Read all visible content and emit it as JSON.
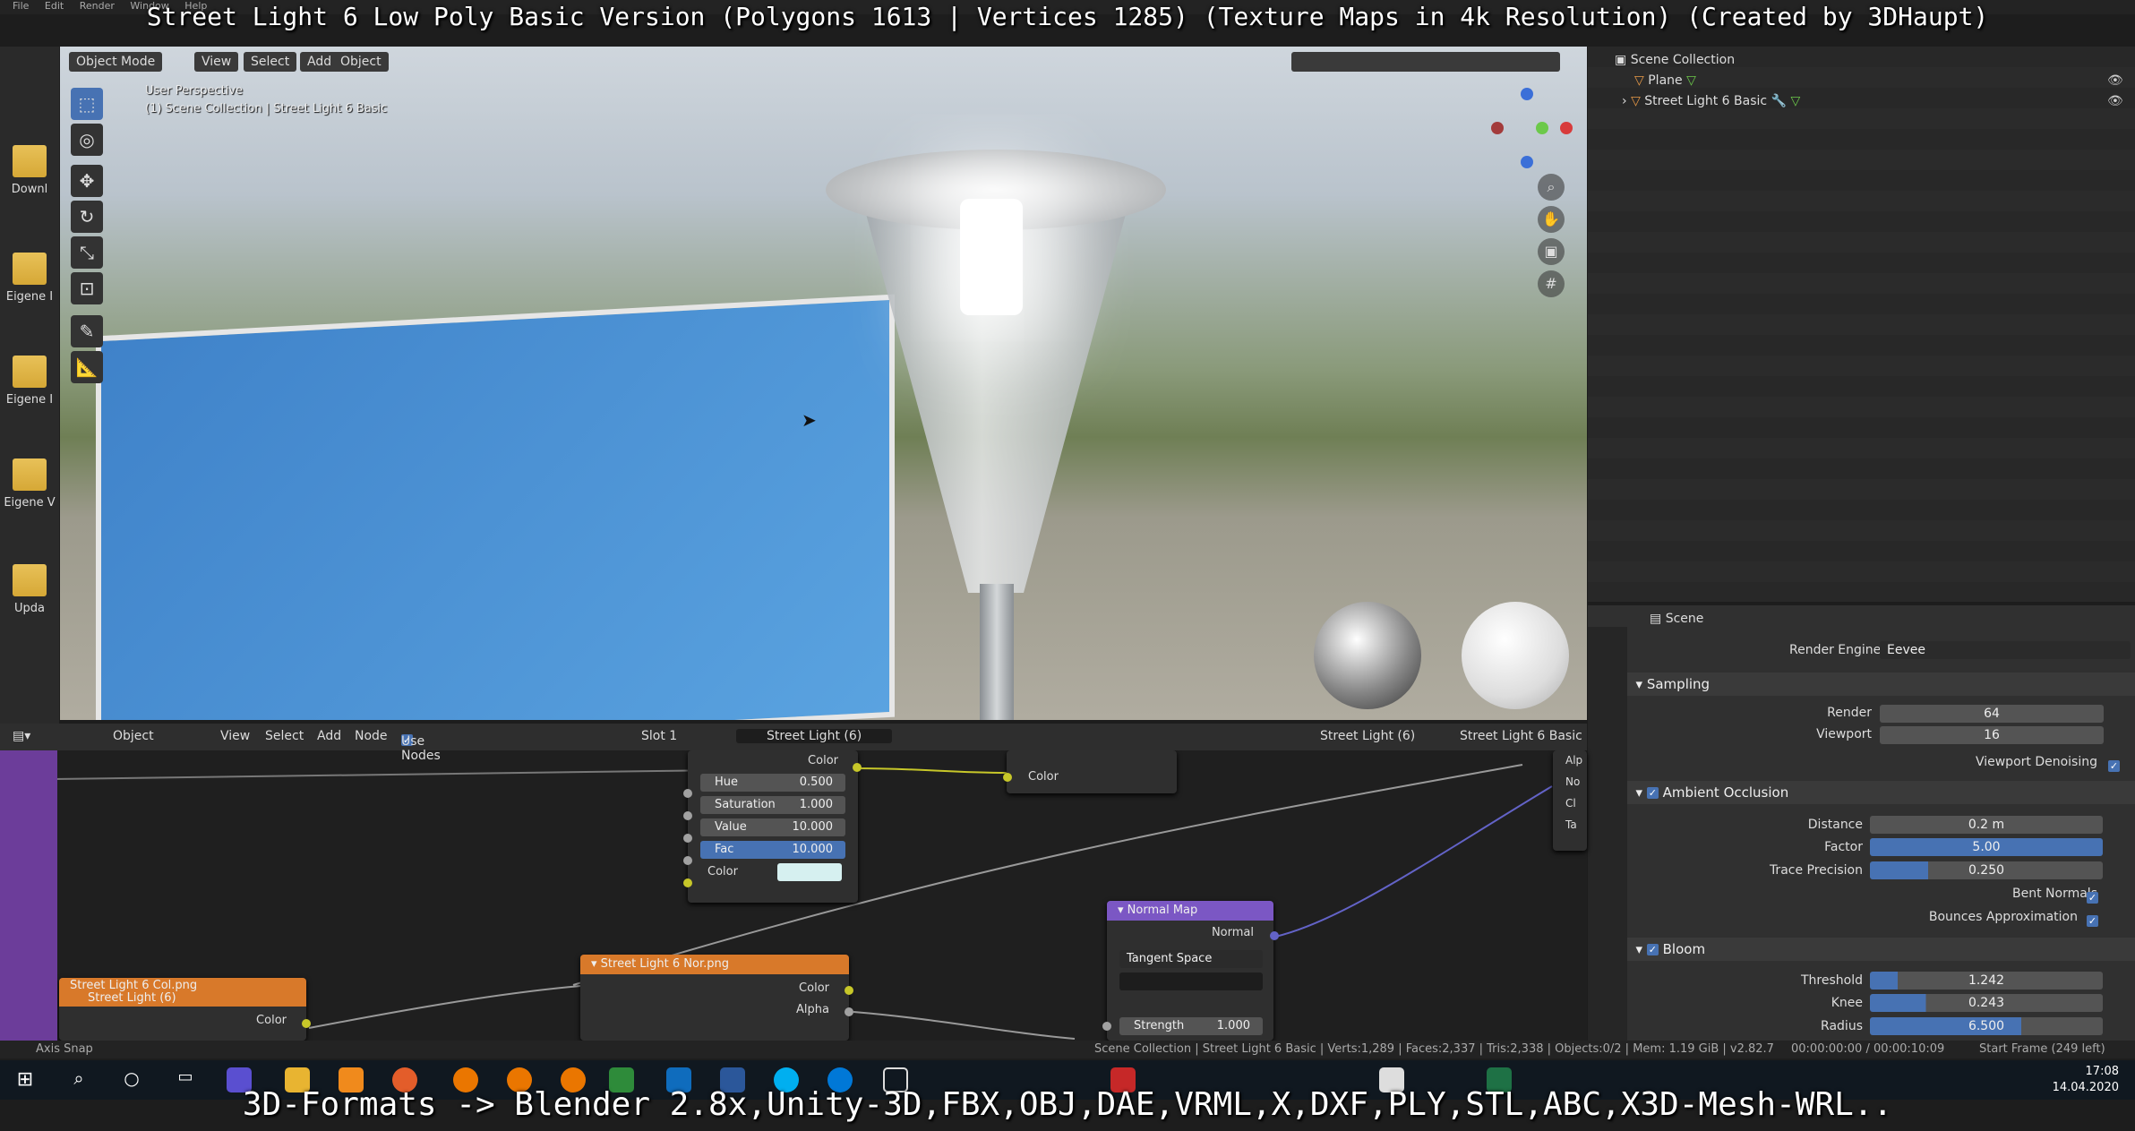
{
  "caption_top": "Street Light 6 Low Poly Basic Version (Polygons 1613 | Vertices 1285) (Texture Maps in 4k Resolution) (Created by 3DHaupt)",
  "caption_bottom": "3D-Formats -> Blender 2.8x,Unity-3D,FBX,OBJ,DAE,VRML,X,DXF,PLY,STL,ABC,X3D-Mesh-WRL..",
  "top_menu": [
    "File",
    "Edit",
    "Render",
    "Window",
    "Help"
  ],
  "desktop_icons": [
    "Downl",
    "Eigene I",
    "Eigene I",
    "Eigene V",
    "Upda"
  ],
  "viewport": {
    "mode": "Object Mode",
    "menus": [
      "View",
      "Select",
      "Add",
      "Object"
    ],
    "perspective": "User Perspective",
    "collection_info": "(1) Scene Collection | Street Light 6 Basic"
  },
  "outliner": {
    "root": "Scene Collection",
    "items": [
      "Plane",
      "Street Light 6 Basic"
    ]
  },
  "properties": {
    "context": "Scene",
    "render_engine_label": "Render Engine",
    "render_engine": "Eevee",
    "sampling": {
      "title": "Sampling",
      "render_label": "Render",
      "render": "64",
      "viewport_label": "Viewport",
      "viewport": "16",
      "denoise_label": "Viewport Denoising"
    },
    "ao": {
      "title": "Ambient Occlusion",
      "distance_label": "Distance",
      "distance": "0.2 m",
      "factor_label": "Factor",
      "factor": "5.00",
      "trace_label": "Trace Precision",
      "trace": "0.250",
      "bent_label": "Bent Normals",
      "bounces_label": "Bounces Approximation"
    },
    "bloom": {
      "title": "Bloom",
      "threshold_label": "Threshold",
      "threshold": "1.242",
      "knee_label": "Knee",
      "knee": "0.243",
      "radius_label": "Radius",
      "radius": "6.500"
    }
  },
  "node_editor": {
    "mode": "Object",
    "menus": [
      "View",
      "Select",
      "Add",
      "Node"
    ],
    "use_nodes": "Use Nodes",
    "slot": "Slot 1",
    "material": "Street Light (6)",
    "object_material": "Street Light (6)",
    "object_name": "Street Light 6 Basic",
    "hsv": {
      "out": "Color",
      "hue_label": "Hue",
      "hue": "0.500",
      "sat_label": "Saturation",
      "sat": "1.000",
      "val_label": "Value",
      "val": "10.000",
      "fac_label": "Fac",
      "fac": "10.000",
      "color_label": "Color"
    },
    "mix_in_color": "Color",
    "normal_map": {
      "title": "Normal Map",
      "out": "Normal",
      "space": "Tangent Space",
      "strength_label": "Strength",
      "strength": "1.000"
    },
    "nor_tex": {
      "title": "Street Light 6 Nor.png",
      "color": "Color",
      "alpha": "Alpha"
    },
    "col_tex": {
      "title": "Street Light 6 Col.png",
      "sub": "Street Light (6)",
      "color": "Color"
    },
    "bsdf_sockets": [
      "Alp",
      "No",
      "Cl",
      "Ta"
    ]
  },
  "status": {
    "left": "Axis Snap",
    "stats": "Scene Collection | Street Light 6 Basic | Verts:1,289 | Faces:2,337 | Tris:2,338 | Objects:0/2 | Mem: 1.19 GiB | v2.82.7",
    "time": "00:00:00:00 / 00:00:10:09",
    "frame": "Start Frame (249 left)"
  },
  "clock": {
    "time": "17:08",
    "date": "14.04.2020"
  },
  "colors": {
    "accent": "#4772b3",
    "socket_yellow": "#c7c729",
    "socket_grey": "#a1a1a1",
    "socket_purple": "#6363c7",
    "node_orange": "#d8792a",
    "node_purple": "#7b57c4"
  }
}
